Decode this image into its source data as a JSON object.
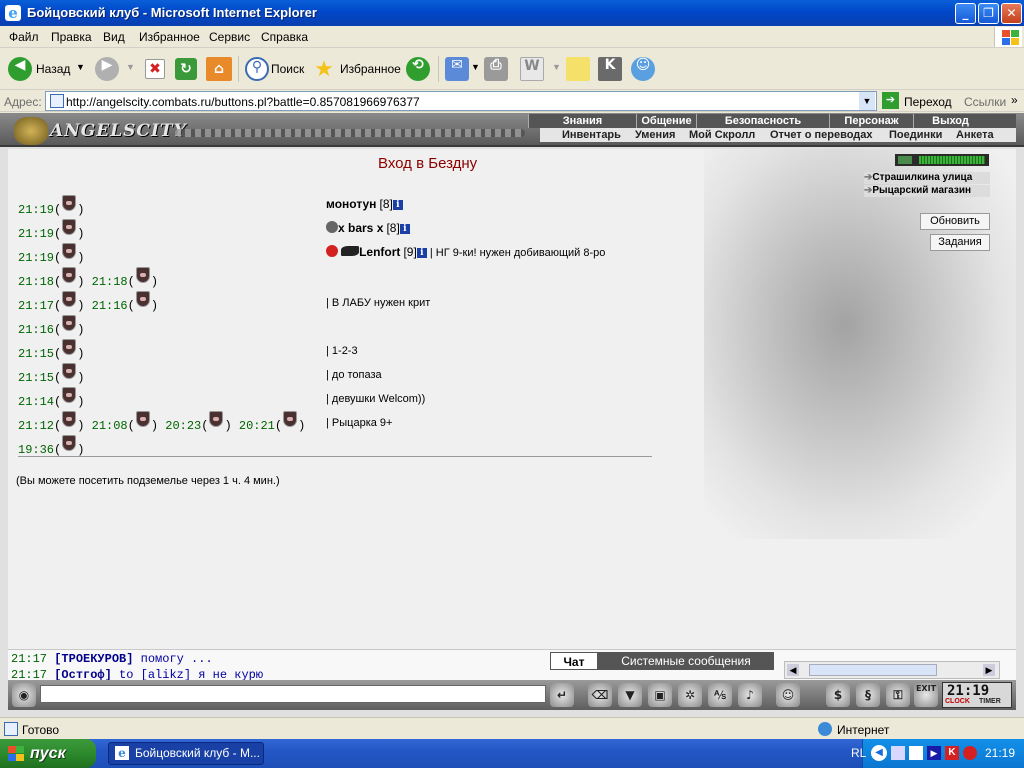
{
  "window": {
    "title": "Бойцовский клуб - Microsoft Internet Explorer",
    "minimize": "_",
    "maximize": "❐",
    "close": "✕"
  },
  "menu": [
    "Файл",
    "Правка",
    "Вид",
    "Избранное",
    "Сервис",
    "Справка"
  ],
  "toolbar": {
    "back": "Назад",
    "search": "Поиск",
    "favorites": "Избранное"
  },
  "address": {
    "label": "Адрес:",
    "url": "http://angelscity.combats.ru/buttons.pl?battle=0.857081966976377",
    "go": "Переход",
    "links": "Ссылки"
  },
  "site": {
    "logo_text": "ANGELSCITY",
    "nav_top": [
      "Знания",
      "Общение",
      "Безопасность",
      "Персонаж",
      "Выход"
    ],
    "nav_bottom": [
      "Инвентарь",
      "Умения",
      "Мой Скролл",
      "Отчет о переводах",
      "Поединки",
      "Анкета"
    ],
    "heading": "Вход в Бездну",
    "right_links": [
      "Страшилкина улица",
      "Рыцарский магазин"
    ],
    "refresh_button": "Обновить",
    "tasks_button": "Задания",
    "rows": [
      {
        "times": [
          "21:19"
        ],
        "player": "монотун",
        "level": "[8]",
        "text": ""
      },
      {
        "times": [
          "21:19"
        ],
        "player": "x bars x",
        "level": "[8]",
        "text": ""
      },
      {
        "times": [
          "21:19"
        ],
        "player": "Lenfort",
        "level": "[9]",
        "text": "| НГ 9-ки! нужен добивающий 8-ро"
      },
      {
        "times": [
          "21:18",
          "21:18"
        ],
        "player": "",
        "level": "",
        "text": ""
      },
      {
        "times": [
          "21:17",
          "21:16"
        ],
        "player": "",
        "level": "",
        "text": "| В ЛАБУ нужен крит"
      },
      {
        "times": [
          "21:16"
        ],
        "player": "",
        "level": "",
        "text": ""
      },
      {
        "times": [
          "21:15"
        ],
        "player": "",
        "level": "",
        "text": "| 1-2-3"
      },
      {
        "times": [
          "21:15"
        ],
        "player": "",
        "level": "",
        "text": "| до топаза"
      },
      {
        "times": [
          "21:14"
        ],
        "player": "",
        "level": "",
        "text": "| девушки Welcom))"
      },
      {
        "times": [
          "21:12",
          "21:08",
          "20:23",
          "20:21"
        ],
        "player": "",
        "level": "",
        "text": "| Рыцарка 9+"
      },
      {
        "times": [
          "19:36"
        ],
        "player": "",
        "level": "",
        "text": ""
      }
    ],
    "notice": "(Вы можете посетить подземелье через 1 ч. 4 мин.)",
    "info_glyph": "i"
  },
  "chat": {
    "tab_chat": "Чат",
    "tab_system": "Системные сообщения",
    "line1_time": "21:17",
    "line1_nick": "[ТРОЕКУРОВ]",
    "line1_text": "помогу ...",
    "line2_time": "21:17",
    "line2_nick": "[Остгоф]",
    "line2_text": "to [alikz] я не курю",
    "clock_time": "21:19",
    "clock_label": "CLOCK",
    "timer_label": "TIMER",
    "exit_label": "EXIT"
  },
  "status": {
    "text": "Готово",
    "zone": "Интернет"
  },
  "taskbar": {
    "start": "пуск",
    "item": "Бойцовский клуб - M...",
    "lang": "RL",
    "time": "21:19"
  },
  "colors": {
    "heading": "#8b0000",
    "time": "#006400",
    "xp_blue": "#0047c9",
    "start_green": "#2c8a2c"
  }
}
